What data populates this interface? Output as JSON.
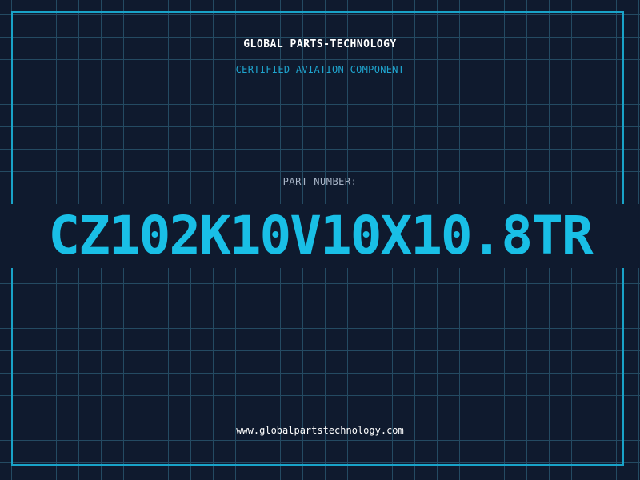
{
  "header": {
    "company": "GLOBAL PARTS-TECHNOLOGY",
    "tagline": "CERTIFIED AVIATION COMPONENT"
  },
  "part": {
    "label": "PART NUMBER:",
    "number": "CZ102K10V10X10.8TR"
  },
  "footer": {
    "url": "www.globalpartstechnology.com"
  },
  "colors": {
    "background": "#0f1a2e",
    "grid": "#244a62",
    "accent": "#19bfe6",
    "frame": "#19a3c8"
  }
}
